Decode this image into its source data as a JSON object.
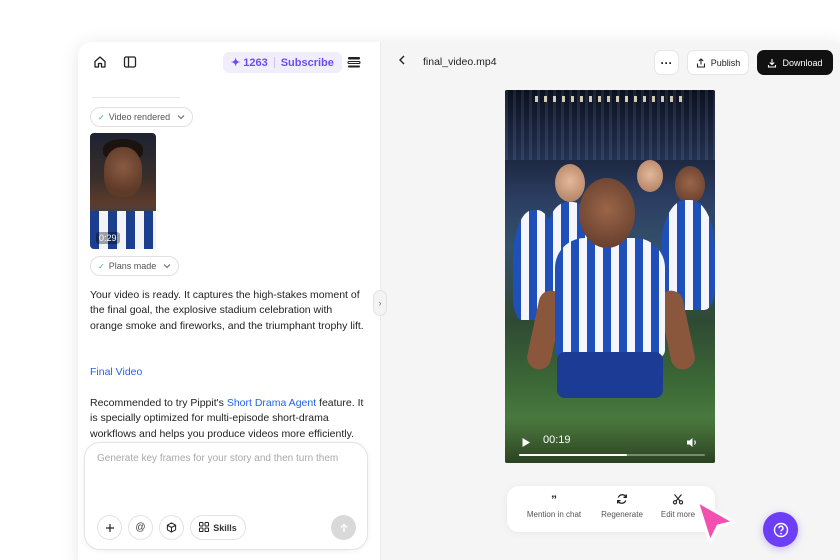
{
  "header": {
    "credits": "1263",
    "subscribe_label": "Subscribe"
  },
  "chat": {
    "status_video": "Video rendered",
    "thumbnail_duration": "0:29",
    "status_plans": "Plans made",
    "message": "Your video is ready. It captures the high-stakes moment of the final goal, the explosive stadium celebration with orange smoke and fireworks, and the triumphant trophy lift.",
    "final_video_link": "Final Video",
    "recommend_prefix": "Recommended to try Pippit's ",
    "recommend_link": "Short Drama Agent",
    "recommend_suffix": " feature. It is specially optimized for multi-episode short-drama workflows and helps you produce videos more efficiently."
  },
  "composer": {
    "placeholder": "Generate key frames for your story and then turn them",
    "skills_label": "Skills"
  },
  "preview": {
    "file_name": "final_video.mp4",
    "publish_label": "Publish",
    "download_label": "Download",
    "time": "00:19",
    "progress": 0.58
  },
  "actions": {
    "mention_label": "Mention in chat",
    "regenerate_label": "Regenerate",
    "edit_label": "Edit more"
  },
  "colors": {
    "accent": "#6a4cf0",
    "link": "#2563eb",
    "help_button": "#6c3ef5",
    "cursor": "#f24fb0"
  }
}
